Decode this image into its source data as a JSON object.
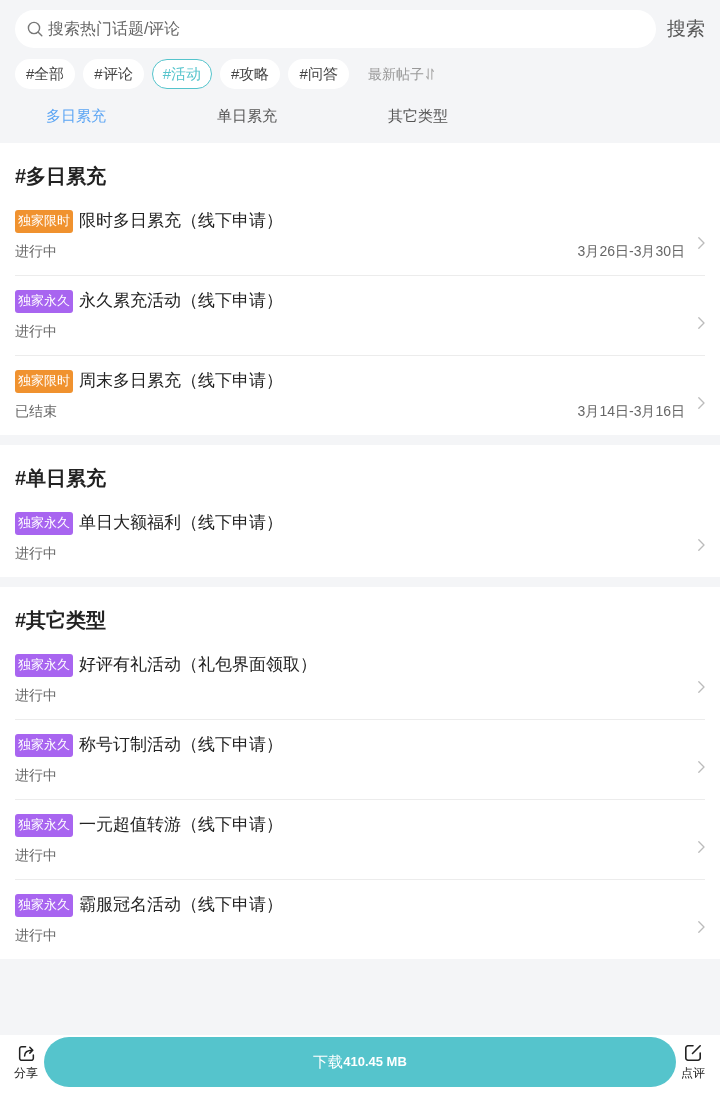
{
  "search": {
    "placeholder": "搜索热门话题/评论",
    "button": "搜索"
  },
  "topic_chips": [
    {
      "label": "#全部",
      "selected": false
    },
    {
      "label": "#评论",
      "selected": false
    },
    {
      "label": "#活动",
      "selected": true
    },
    {
      "label": "#攻略",
      "selected": false
    },
    {
      "label": "#问答",
      "selected": false
    }
  ],
  "sort": {
    "label": "最新帖子"
  },
  "category_tabs": [
    {
      "label": "多日累充",
      "selected": true
    },
    {
      "label": "单日累充",
      "selected": false
    },
    {
      "label": "其它类型",
      "selected": false
    }
  ],
  "sections": [
    {
      "title": "#多日累充",
      "items": [
        {
          "badge": {
            "label": "独家限时",
            "color": "#f0922f"
          },
          "title": "限时多日累充（线下申请）",
          "status": "进行中",
          "dates": "3月26日-3月30日"
        },
        {
          "badge": {
            "label": "独家永久",
            "color": "#a865f0"
          },
          "title": "永久累充活动（线下申请）",
          "status": "进行中"
        },
        {
          "badge": {
            "label": "独家限时",
            "color": "#f0922f"
          },
          "title": "周末多日累充（线下申请）",
          "status": "已结束",
          "dates": "3月14日-3月16日"
        }
      ]
    },
    {
      "title": "#单日累充",
      "items": [
        {
          "badge": {
            "label": "独家永久",
            "color": "#a865f0"
          },
          "title": "单日大额福利（线下申请）",
          "status": "进行中"
        }
      ]
    },
    {
      "title": "#其它类型",
      "items": [
        {
          "badge": {
            "label": "独家永久",
            "color": "#a865f0"
          },
          "title": "好评有礼活动（礼包界面领取）",
          "status": "进行中"
        },
        {
          "badge": {
            "label": "独家永久",
            "color": "#a865f0"
          },
          "title": "称号订制活动（线下申请）",
          "status": "进行中"
        },
        {
          "badge": {
            "label": "独家永久",
            "color": "#a865f0"
          },
          "title": "一元超值转游（线下申请）",
          "status": "进行中"
        },
        {
          "badge": {
            "label": "独家永久",
            "color": "#a865f0"
          },
          "title": "霸服冠名活动（线下申请）",
          "status": "进行中"
        }
      ]
    }
  ],
  "bottom_bar": {
    "share": "分享",
    "download": {
      "label": "下载",
      "size": "410.45 MB"
    },
    "review": "点评"
  }
}
